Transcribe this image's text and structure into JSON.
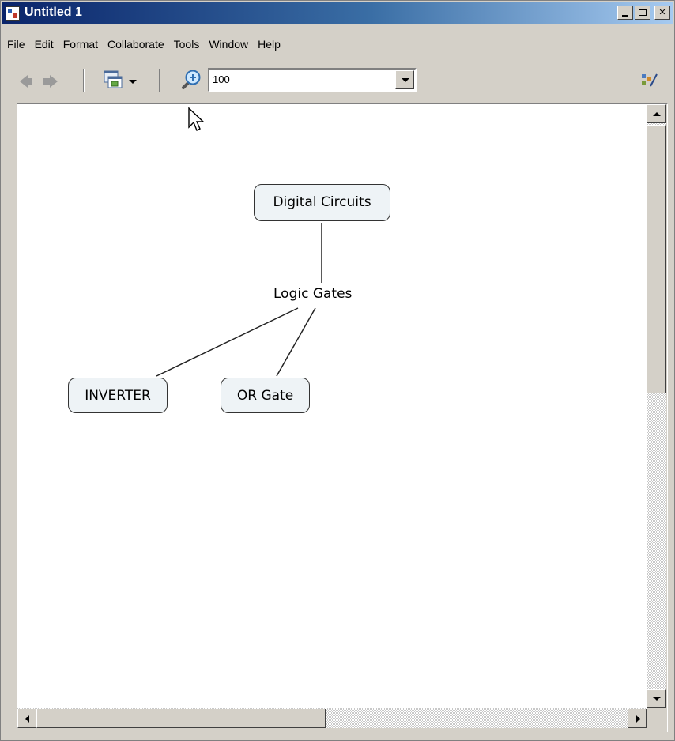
{
  "window": {
    "title": "Untitled 1"
  },
  "menu": {
    "items": [
      "File",
      "Edit",
      "Format",
      "Collaborate",
      "Tools",
      "Window",
      "Help"
    ]
  },
  "toolbar": {
    "zoom_value": "100",
    "icons": [
      "back-arrow-icon",
      "forward-arrow-icon",
      "views-icon",
      "zoom-icon",
      "edit-styles-icon"
    ]
  },
  "map": {
    "root": "Digital Circuits",
    "link": "Logic Gates",
    "children": [
      "INVERTER",
      "OR Gate"
    ]
  }
}
